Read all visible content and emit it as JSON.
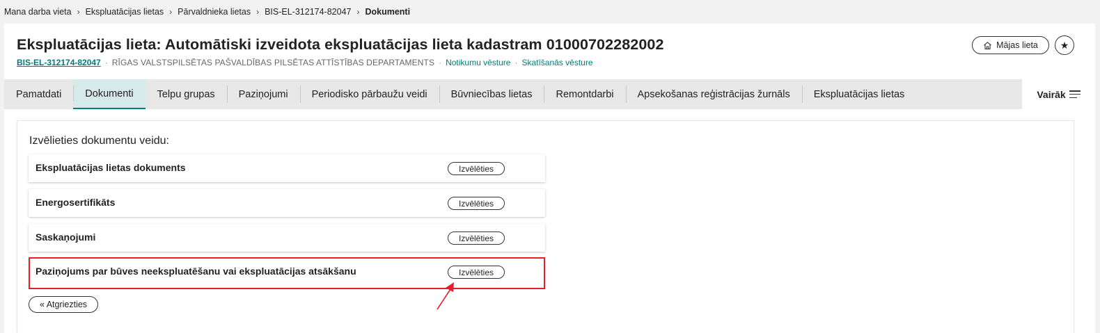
{
  "breadcrumb": {
    "items": [
      "Mana darba vieta",
      "Ekspluatācijas lietas",
      "Pārvaldnieka lietas",
      "BIS-EL-312174-82047"
    ],
    "current": "Dokumenti"
  },
  "header": {
    "title": "Ekspluatācijas lieta: Automātiski izveidota ekspluatācijas lieta kadastram 01000702282002",
    "case_id": "BIS-EL-312174-82047",
    "organization": "RĪGAS VALSTSPILSĒTAS PAŠVALDĪBAS PILSĒTAS ATTĪSTĪBAS DEPARTAMENTS",
    "events_link": "Notikumu vēsture",
    "views_link": "Skatīšanās vēsture",
    "house_button": "Mājas lieta"
  },
  "tabs": {
    "items": [
      "Pamatdati",
      "Dokumenti",
      "Telpu grupas",
      "Paziņojumi",
      "Periodisko pārbaužu veidi",
      "Būvniecības lietas",
      "Remontdarbi",
      "Apsekošanas reģistrācijas žurnāls",
      "Ekspluatācijas lietas"
    ],
    "active": "Dokumenti",
    "more": "Vairāk"
  },
  "panel": {
    "title": "Izvēlieties dokumentu veidu:",
    "select_label": "Izvēlēties",
    "documents": [
      "Ekspluatācijas lietas dokuments",
      "Energosertifikāts",
      "Saskaņojumi",
      "Paziņojums par būves neekspluatēšanu vai ekspluatācijas atsākšanu"
    ],
    "back_button": "« Atgriezties"
  },
  "colors": {
    "accent": "#008080",
    "highlight": "#e3202a",
    "active_tab_bg": "#d6eaea"
  }
}
